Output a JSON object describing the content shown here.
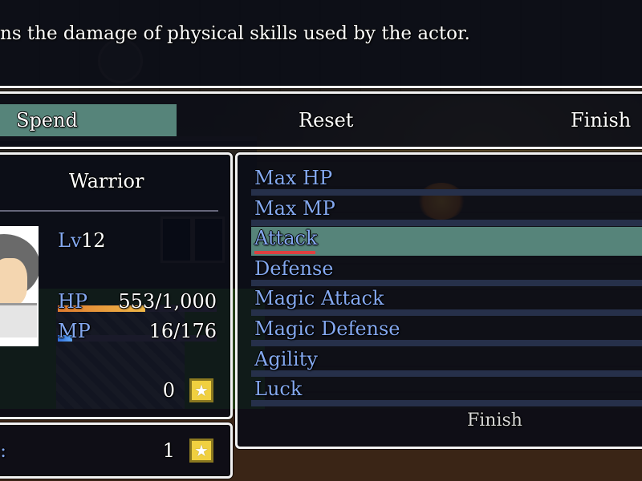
{
  "help": {
    "text": "ns the damage of physical skills used by the actor."
  },
  "commands": {
    "spend": "Spend",
    "reset": "Reset",
    "finish": "Finish"
  },
  "actor": {
    "class": "Warrior",
    "level_label": "Lv",
    "level": "12",
    "hp_label": "HP",
    "hp_value": "553/1,000",
    "hp_ratio": 0.553,
    "mp_label": "MP",
    "mp_value": "16/176",
    "mp_ratio": 0.091,
    "points": "0"
  },
  "params": [
    {
      "label": "Max HP"
    },
    {
      "label": "Max MP"
    },
    {
      "label": "Attack"
    },
    {
      "label": "Defense"
    },
    {
      "label": "Magic Attack"
    },
    {
      "label": "Magic Defense"
    },
    {
      "label": "Agility"
    },
    {
      "label": "Luck"
    }
  ],
  "selected_param": "Attack",
  "param_finish": "Finish",
  "total_points": {
    "label": ":",
    "value": "1"
  },
  "icons": {
    "star": "star-icon"
  },
  "colors": {
    "highlight": "#56847a",
    "system_blue": "#84a8f0",
    "hp_gauge": "#e07c30",
    "mp_gauge": "#3070e0"
  }
}
